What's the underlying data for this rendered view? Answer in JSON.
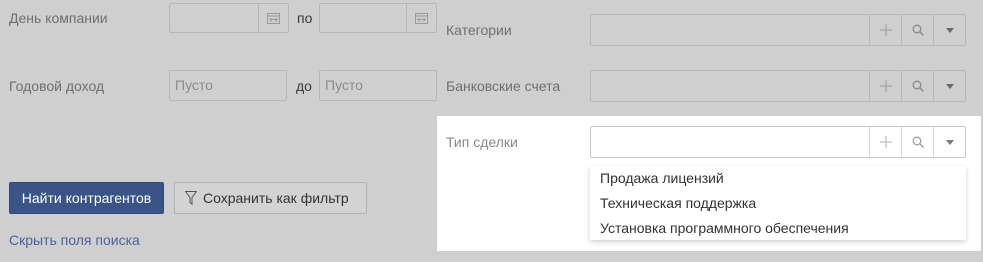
{
  "filters": {
    "company_day": {
      "label": "День компании",
      "conj": "по"
    },
    "annual_income": {
      "label": "Годовой доход",
      "conj": "до",
      "from_placeholder": "Пусто",
      "to_placeholder": "Пусто"
    },
    "categories": {
      "label": "Категории"
    },
    "bank_accounts": {
      "label": "Банковские счета"
    },
    "deal_type": {
      "label": "Тип сделки",
      "options": [
        "Продажа лицензий",
        "Техническая поддержка",
        "Установка программного обеспечения"
      ]
    }
  },
  "actions": {
    "find_label": "Найти контрагентов",
    "save_filter_label": "Сохранить как фильтр",
    "hide_fields_label": "Скрыть поля поиска"
  },
  "icons": {
    "calendar": "calendar-icon",
    "add": "plus-icon",
    "search": "search-icon",
    "dropdown": "caret-down-icon",
    "filter": "funnel-icon"
  },
  "colors": {
    "primary": "#3a5488",
    "link": "#4a63a0",
    "overlay_bg": "#cfcfcf"
  }
}
